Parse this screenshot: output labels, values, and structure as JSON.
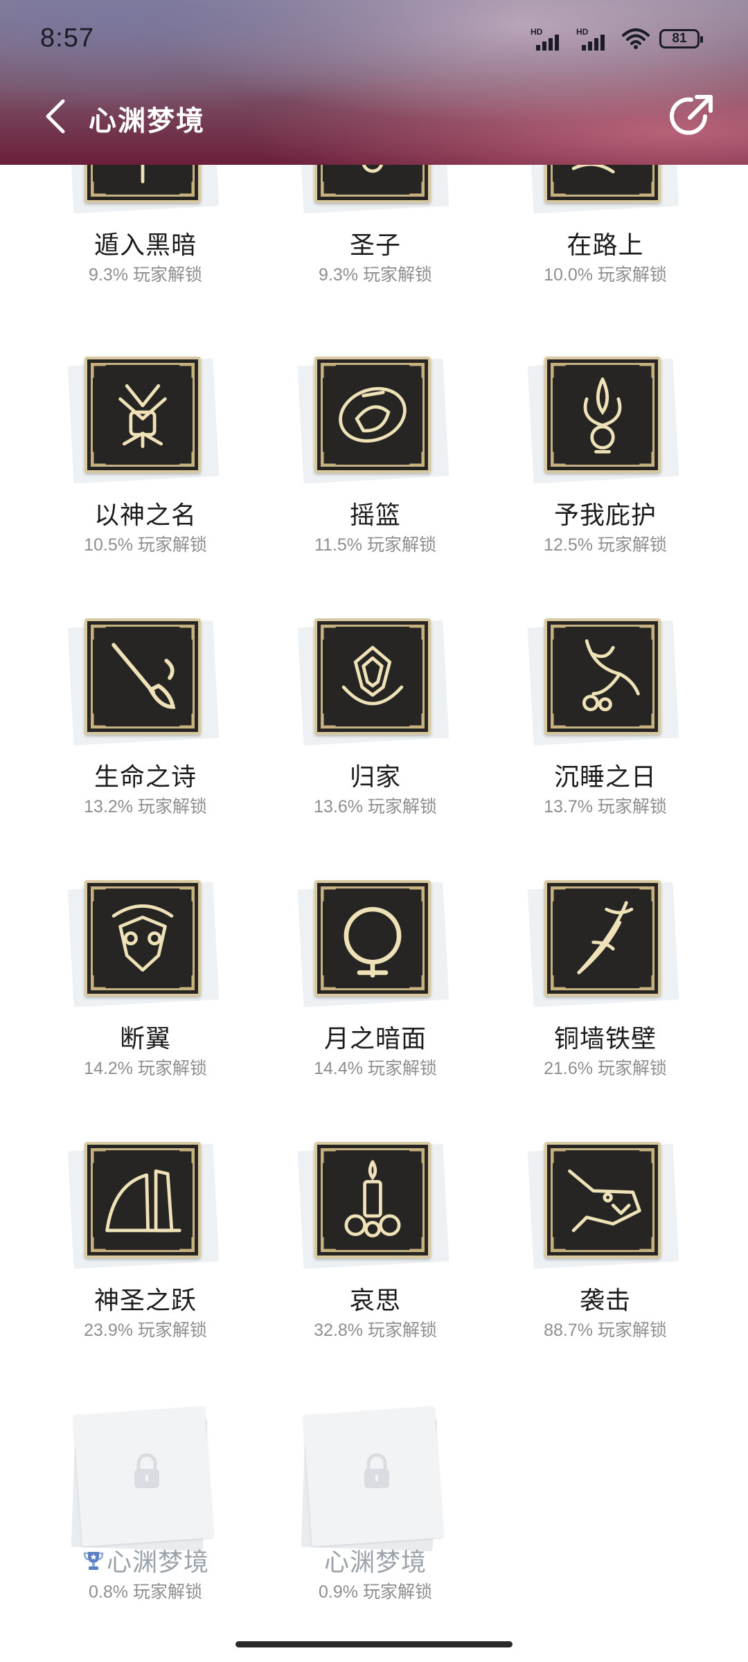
{
  "status_bar": {
    "time": "8:57",
    "signal_1_label": "HD",
    "signal_2_label": "HD",
    "battery": "81"
  },
  "nav": {
    "title": "心渊梦境",
    "back_icon": "chevron-left-icon",
    "share_icon": "share-icon"
  },
  "achievements": [
    {
      "name": "遁入黑暗",
      "rate": "9.3% 玩家解锁",
      "locked": false,
      "icon": "dark-emblem-icon"
    },
    {
      "name": "圣子",
      "rate": "9.3% 玩家解锁",
      "locked": false,
      "icon": "holy-child-icon"
    },
    {
      "name": "在路上",
      "rate": "10.0% 玩家解锁",
      "locked": false,
      "icon": "road-icon"
    },
    {
      "name": "以神之名",
      "rate": "10.5% 玩家解锁",
      "locked": false,
      "icon": "fist-icon"
    },
    {
      "name": "摇篮",
      "rate": "11.5% 玩家解锁",
      "locked": false,
      "icon": "cradle-icon"
    },
    {
      "name": "予我庇护",
      "rate": "12.5% 玩家解锁",
      "locked": false,
      "icon": "spirit-icon"
    },
    {
      "name": "生命之诗",
      "rate": "13.2% 玩家解锁",
      "locked": false,
      "icon": "brush-icon"
    },
    {
      "name": "归家",
      "rate": "13.6% 玩家解锁",
      "locked": false,
      "icon": "crest-icon"
    },
    {
      "name": "沉睡之日",
      "rate": "13.7% 玩家解锁",
      "locked": false,
      "icon": "bird-icon"
    },
    {
      "name": "断翼",
      "rate": "14.2% 玩家解锁",
      "locked": false,
      "icon": "broken-wing-icon"
    },
    {
      "name": "月之暗面",
      "rate": "14.4% 玩家解锁",
      "locked": false,
      "icon": "moon-ring-icon"
    },
    {
      "name": "铜墙铁壁",
      "rate": "21.6% 玩家解锁",
      "locked": false,
      "icon": "blade-icon"
    },
    {
      "name": "神圣之跃",
      "rate": "23.9% 玩家解锁",
      "locked": false,
      "icon": "cliff-icon"
    },
    {
      "name": "哀思",
      "rate": "32.8% 玩家解锁",
      "locked": false,
      "icon": "candle-icon"
    },
    {
      "name": "袭击",
      "rate": "88.7% 玩家解锁",
      "locked": false,
      "icon": "beast-head-icon"
    },
    {
      "name": "心渊梦境",
      "rate": "0.8% 玩家解锁",
      "locked": true,
      "icon": "lock-icon",
      "trophy": true
    },
    {
      "name": "心渊梦境",
      "rate": "0.9% 玩家解锁",
      "locked": true,
      "icon": "lock-icon",
      "trophy": false
    }
  ],
  "colors": {
    "badge_bg": "#262523",
    "badge_gold": "#e8d8a8",
    "locked_text": "#9aa2aa",
    "rate_text": "#8e8e8e"
  }
}
